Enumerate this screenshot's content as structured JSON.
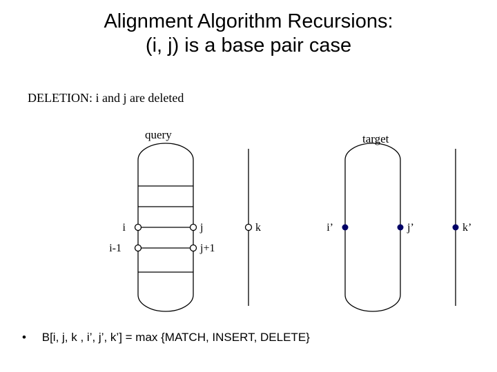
{
  "title_line1": "Alignment Algorithm Recursions:",
  "title_line2": "(i, j) is a base pair case",
  "subhead": "DELETION: i and j are deleted",
  "labels": {
    "query": "query",
    "target": "target"
  },
  "points": {
    "i": "i",
    "i_minus_1": "i-1",
    "j": "j",
    "j_plus_1": "j+1",
    "k": "k",
    "i_prime": "i’",
    "j_prime": "j’",
    "k_prime": "k’"
  },
  "bullet": "B[i, j, k , i’, j’, k’] = max {MATCH, INSERT, DELETE}",
  "colors": {
    "hollow_stroke": "#000000",
    "filled_fill": "#000066"
  }
}
